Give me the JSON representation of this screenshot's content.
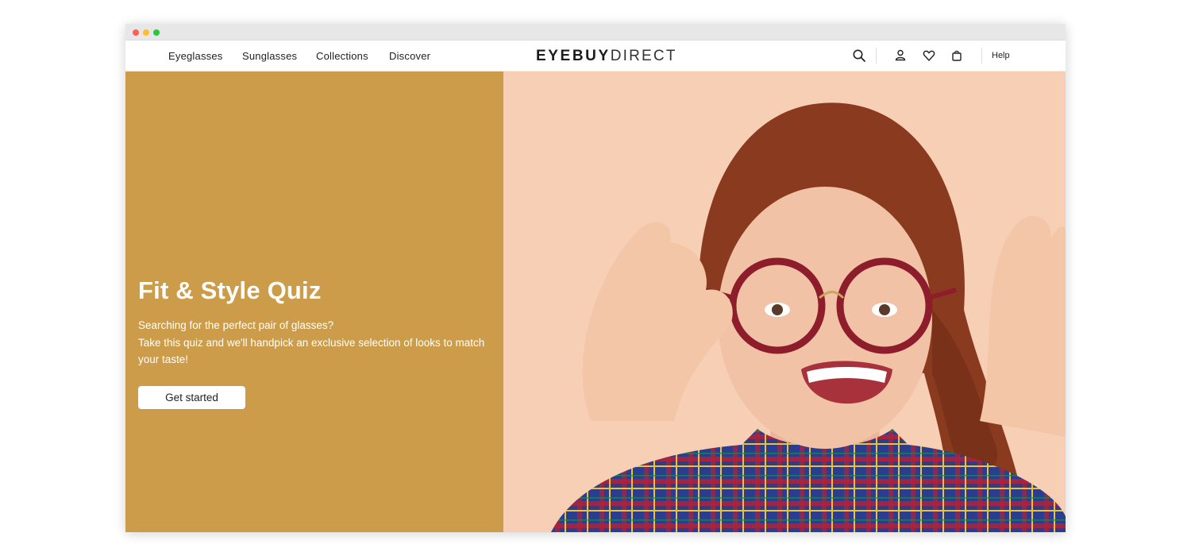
{
  "nav": {
    "links": [
      "Eyeglasses",
      "Sunglasses",
      "Collections",
      "Discover"
    ],
    "logo_bold": "EYEBUY",
    "logo_light": "DIRECT",
    "help_label": "Help",
    "icons": [
      "search-icon",
      "account-icon",
      "wishlist-icon",
      "bag-icon"
    ]
  },
  "promo": {
    "title": "Fit & Style Quiz",
    "text_line1": "Searching for the perfect pair of glasses?",
    "text_line2": "Take this quiz and we'll handpick an exclusive selection of looks to match your taste!",
    "cta_label": "Get started"
  },
  "colors": {
    "promo_bg": "#cd9c4a",
    "photo_bg": "#f6cfb4",
    "frame_color": "#8e1d2c"
  }
}
